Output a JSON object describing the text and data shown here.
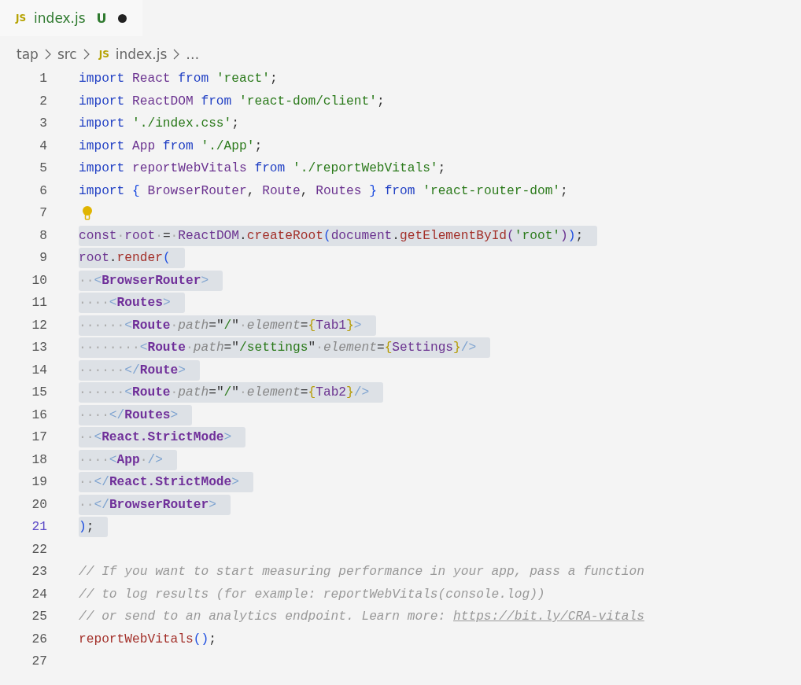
{
  "tab": {
    "icon": "JS",
    "label": "index.js",
    "status": "U",
    "dirty": true
  },
  "breadcrumb": [
    {
      "label": "tap",
      "kind": "folder"
    },
    {
      "label": "src",
      "kind": "folder"
    },
    {
      "icon": "JS",
      "label": "index.js",
      "kind": "file"
    },
    {
      "label": "…",
      "kind": "more"
    }
  ],
  "lines": [
    {
      "number": "1",
      "selected": false,
      "current": false,
      "tokens": [
        {
          "kind": "kw",
          "text": "import "
        },
        {
          "kind": "id",
          "text": "React "
        },
        {
          "kind": "kw",
          "text": "from "
        },
        {
          "kind": "str",
          "text": "'react'"
        },
        {
          "kind": "p",
          "text": ";"
        }
      ]
    },
    {
      "number": "2",
      "selected": false,
      "current": false,
      "tokens": [
        {
          "kind": "kw",
          "text": "import "
        },
        {
          "kind": "id",
          "text": "ReactDOM "
        },
        {
          "kind": "kw",
          "text": "from "
        },
        {
          "kind": "str",
          "text": "'react-dom/client'"
        },
        {
          "kind": "p",
          "text": ";"
        }
      ]
    },
    {
      "number": "3",
      "selected": false,
      "current": false,
      "tokens": [
        {
          "kind": "kw",
          "text": "import "
        },
        {
          "kind": "str",
          "text": "'./index.css'"
        },
        {
          "kind": "p",
          "text": ";"
        }
      ]
    },
    {
      "number": "4",
      "selected": false,
      "current": false,
      "tokens": [
        {
          "kind": "kw",
          "text": "import "
        },
        {
          "kind": "id",
          "text": "App "
        },
        {
          "kind": "kw",
          "text": "from "
        },
        {
          "kind": "str",
          "text": "'./App'"
        },
        {
          "kind": "p",
          "text": ";"
        }
      ]
    },
    {
      "number": "5",
      "selected": false,
      "current": false,
      "tokens": [
        {
          "kind": "kw",
          "text": "import "
        },
        {
          "kind": "id",
          "text": "reportWebVitals "
        },
        {
          "kind": "kw",
          "text": "from "
        },
        {
          "kind": "str",
          "text": "'./reportWebVitals'"
        },
        {
          "kind": "p",
          "text": ";"
        }
      ]
    },
    {
      "number": "6",
      "selected": false,
      "current": false,
      "tokens": [
        {
          "kind": "kw",
          "text": "import "
        },
        {
          "kind": "paren",
          "text": "{ "
        },
        {
          "kind": "id",
          "text": "BrowserRouter"
        },
        {
          "kind": "p",
          "text": ", "
        },
        {
          "kind": "id",
          "text": "Route"
        },
        {
          "kind": "p",
          "text": ", "
        },
        {
          "kind": "id",
          "text": "Routes "
        },
        {
          "kind": "paren",
          "text": "} "
        },
        {
          "kind": "kw",
          "text": "from "
        },
        {
          "kind": "str",
          "text": "'react-router-dom'"
        },
        {
          "kind": "p",
          "text": ";"
        }
      ]
    },
    {
      "number": "7",
      "selected": false,
      "current": false,
      "lightbulb": true
    },
    {
      "number": "8",
      "selected": true,
      "current": false,
      "tokens": [
        {
          "kind": "id",
          "text": "const"
        },
        {
          "kind": "ws",
          "text": "·"
        },
        {
          "kind": "id",
          "text": "root"
        },
        {
          "kind": "ws",
          "text": "·"
        },
        {
          "kind": "p",
          "text": "="
        },
        {
          "kind": "ws",
          "text": "·"
        },
        {
          "kind": "id",
          "text": "ReactDOM"
        },
        {
          "kind": "p",
          "text": "."
        },
        {
          "kind": "fn",
          "text": "createRoot"
        },
        {
          "kind": "paren",
          "text": "("
        },
        {
          "kind": "id",
          "text": "document"
        },
        {
          "kind": "p",
          "text": "."
        },
        {
          "kind": "fn",
          "text": "getElementById"
        },
        {
          "kind": "id",
          "text": "("
        },
        {
          "kind": "str",
          "text": "'root'"
        },
        {
          "kind": "id",
          "text": ")"
        },
        {
          "kind": "paren",
          "text": ")"
        },
        {
          "kind": "p",
          "text": ";"
        }
      ]
    },
    {
      "number": "9",
      "selected": true,
      "current": false,
      "tokens": [
        {
          "kind": "id",
          "text": "root"
        },
        {
          "kind": "p",
          "text": "."
        },
        {
          "kind": "fn",
          "text": "render"
        },
        {
          "kind": "paren",
          "text": "("
        }
      ]
    },
    {
      "number": "10",
      "selected": true,
      "current": false,
      "tokens": [
        {
          "kind": "ws",
          "text": "··"
        },
        {
          "kind": "br",
          "text": "<"
        },
        {
          "kind": "tag",
          "text": "BrowserRouter"
        },
        {
          "kind": "br",
          "text": ">"
        }
      ]
    },
    {
      "number": "11",
      "selected": true,
      "current": false,
      "tokens": [
        {
          "kind": "ws",
          "text": "····"
        },
        {
          "kind": "br",
          "text": "<"
        },
        {
          "kind": "tag",
          "text": "Routes"
        },
        {
          "kind": "br",
          "text": ">"
        }
      ]
    },
    {
      "number": "12",
      "selected": true,
      "current": false,
      "tokens": [
        {
          "kind": "ws",
          "text": "······"
        },
        {
          "kind": "br",
          "text": "<"
        },
        {
          "kind": "tag",
          "text": "Route"
        },
        {
          "kind": "ws",
          "text": "·"
        },
        {
          "kind": "attr",
          "text": "path"
        },
        {
          "kind": "p",
          "text": "=\""
        },
        {
          "kind": "str",
          "text": "/"
        },
        {
          "kind": "p",
          "text": "\""
        },
        {
          "kind": "ws",
          "text": "·"
        },
        {
          "kind": "attr",
          "text": "element"
        },
        {
          "kind": "p",
          "text": "="
        },
        {
          "kind": "brace",
          "text": "{"
        },
        {
          "kind": "id",
          "text": "Tab1"
        },
        {
          "kind": "brace",
          "text": "}"
        },
        {
          "kind": "br",
          "text": ">"
        }
      ]
    },
    {
      "number": "13",
      "selected": true,
      "current": false,
      "tokens": [
        {
          "kind": "ws",
          "text": "········"
        },
        {
          "kind": "br",
          "text": "<"
        },
        {
          "kind": "tag",
          "text": "Route"
        },
        {
          "kind": "ws",
          "text": "·"
        },
        {
          "kind": "attr",
          "text": "path"
        },
        {
          "kind": "p",
          "text": "=\""
        },
        {
          "kind": "str",
          "text": "/settings"
        },
        {
          "kind": "p",
          "text": "\""
        },
        {
          "kind": "ws",
          "text": "·"
        },
        {
          "kind": "attr",
          "text": "element"
        },
        {
          "kind": "p",
          "text": "="
        },
        {
          "kind": "brace",
          "text": "{"
        },
        {
          "kind": "id",
          "text": "Settings"
        },
        {
          "kind": "brace",
          "text": "}"
        },
        {
          "kind": "br",
          "text": "/>"
        }
      ]
    },
    {
      "number": "14",
      "selected": true,
      "current": false,
      "tokens": [
        {
          "kind": "ws",
          "text": "······"
        },
        {
          "kind": "br",
          "text": "</"
        },
        {
          "kind": "tag",
          "text": "Route"
        },
        {
          "kind": "br",
          "text": ">"
        }
      ]
    },
    {
      "number": "15",
      "selected": true,
      "current": false,
      "tokens": [
        {
          "kind": "ws",
          "text": "······"
        },
        {
          "kind": "br",
          "text": "<"
        },
        {
          "kind": "tag",
          "text": "Route"
        },
        {
          "kind": "ws",
          "text": "·"
        },
        {
          "kind": "attr",
          "text": "path"
        },
        {
          "kind": "p",
          "text": "=\""
        },
        {
          "kind": "str",
          "text": "/"
        },
        {
          "kind": "p",
          "text": "\""
        },
        {
          "kind": "ws",
          "text": "·"
        },
        {
          "kind": "attr",
          "text": "element"
        },
        {
          "kind": "p",
          "text": "="
        },
        {
          "kind": "brace",
          "text": "{"
        },
        {
          "kind": "id",
          "text": "Tab2"
        },
        {
          "kind": "brace",
          "text": "}"
        },
        {
          "kind": "br",
          "text": "/>"
        }
      ]
    },
    {
      "number": "16",
      "selected": true,
      "current": false,
      "tokens": [
        {
          "kind": "ws",
          "text": "····"
        },
        {
          "kind": "br",
          "text": "</"
        },
        {
          "kind": "tag",
          "text": "Routes"
        },
        {
          "kind": "br",
          "text": ">"
        }
      ]
    },
    {
      "number": "17",
      "selected": true,
      "current": false,
      "tokens": [
        {
          "kind": "ws",
          "text": "··"
        },
        {
          "kind": "br",
          "text": "<"
        },
        {
          "kind": "tag",
          "text": "React.StrictMode"
        },
        {
          "kind": "br",
          "text": ">"
        }
      ]
    },
    {
      "number": "18",
      "selected": true,
      "current": false,
      "tokens": [
        {
          "kind": "ws",
          "text": "····"
        },
        {
          "kind": "br",
          "text": "<"
        },
        {
          "kind": "tag",
          "text": "App"
        },
        {
          "kind": "ws",
          "text": "·"
        },
        {
          "kind": "br",
          "text": "/>"
        }
      ]
    },
    {
      "number": "19",
      "selected": true,
      "current": false,
      "tokens": [
        {
          "kind": "ws",
          "text": "··"
        },
        {
          "kind": "br",
          "text": "</"
        },
        {
          "kind": "tag",
          "text": "React.StrictMode"
        },
        {
          "kind": "br",
          "text": ">"
        }
      ]
    },
    {
      "number": "20",
      "selected": true,
      "current": false,
      "tokens": [
        {
          "kind": "ws",
          "text": "··"
        },
        {
          "kind": "br",
          "text": "</"
        },
        {
          "kind": "tag",
          "text": "BrowserRouter"
        },
        {
          "kind": "br",
          "text": ">"
        }
      ]
    },
    {
      "number": "21",
      "selected": true,
      "current": true,
      "tokens": [
        {
          "kind": "paren",
          "text": ")"
        },
        {
          "kind": "p",
          "text": ";"
        }
      ]
    },
    {
      "number": "22",
      "selected": false,
      "current": false
    },
    {
      "number": "23",
      "selected": false,
      "current": false,
      "tokens": [
        {
          "kind": "cm",
          "text": "// If you want to start measuring performance in your app, pass a function"
        }
      ]
    },
    {
      "number": "24",
      "selected": false,
      "current": false,
      "tokens": [
        {
          "kind": "cm",
          "text": "// to log results (for example: reportWebVitals(console.log))"
        }
      ]
    },
    {
      "number": "25",
      "selected": false,
      "current": false,
      "tokens": [
        {
          "kind": "cm",
          "text": "// or send to an analytics endpoint. Learn more: "
        },
        {
          "kind": "link",
          "text": "https://bit.ly/CRA-vitals"
        }
      ]
    },
    {
      "number": "26",
      "selected": false,
      "current": false,
      "tokens": [
        {
          "kind": "fn",
          "text": "reportWebVitals"
        },
        {
          "kind": "paren",
          "text": "()"
        },
        {
          "kind": "p",
          "text": ";"
        }
      ]
    },
    {
      "number": "27",
      "selected": false,
      "current": false
    }
  ]
}
